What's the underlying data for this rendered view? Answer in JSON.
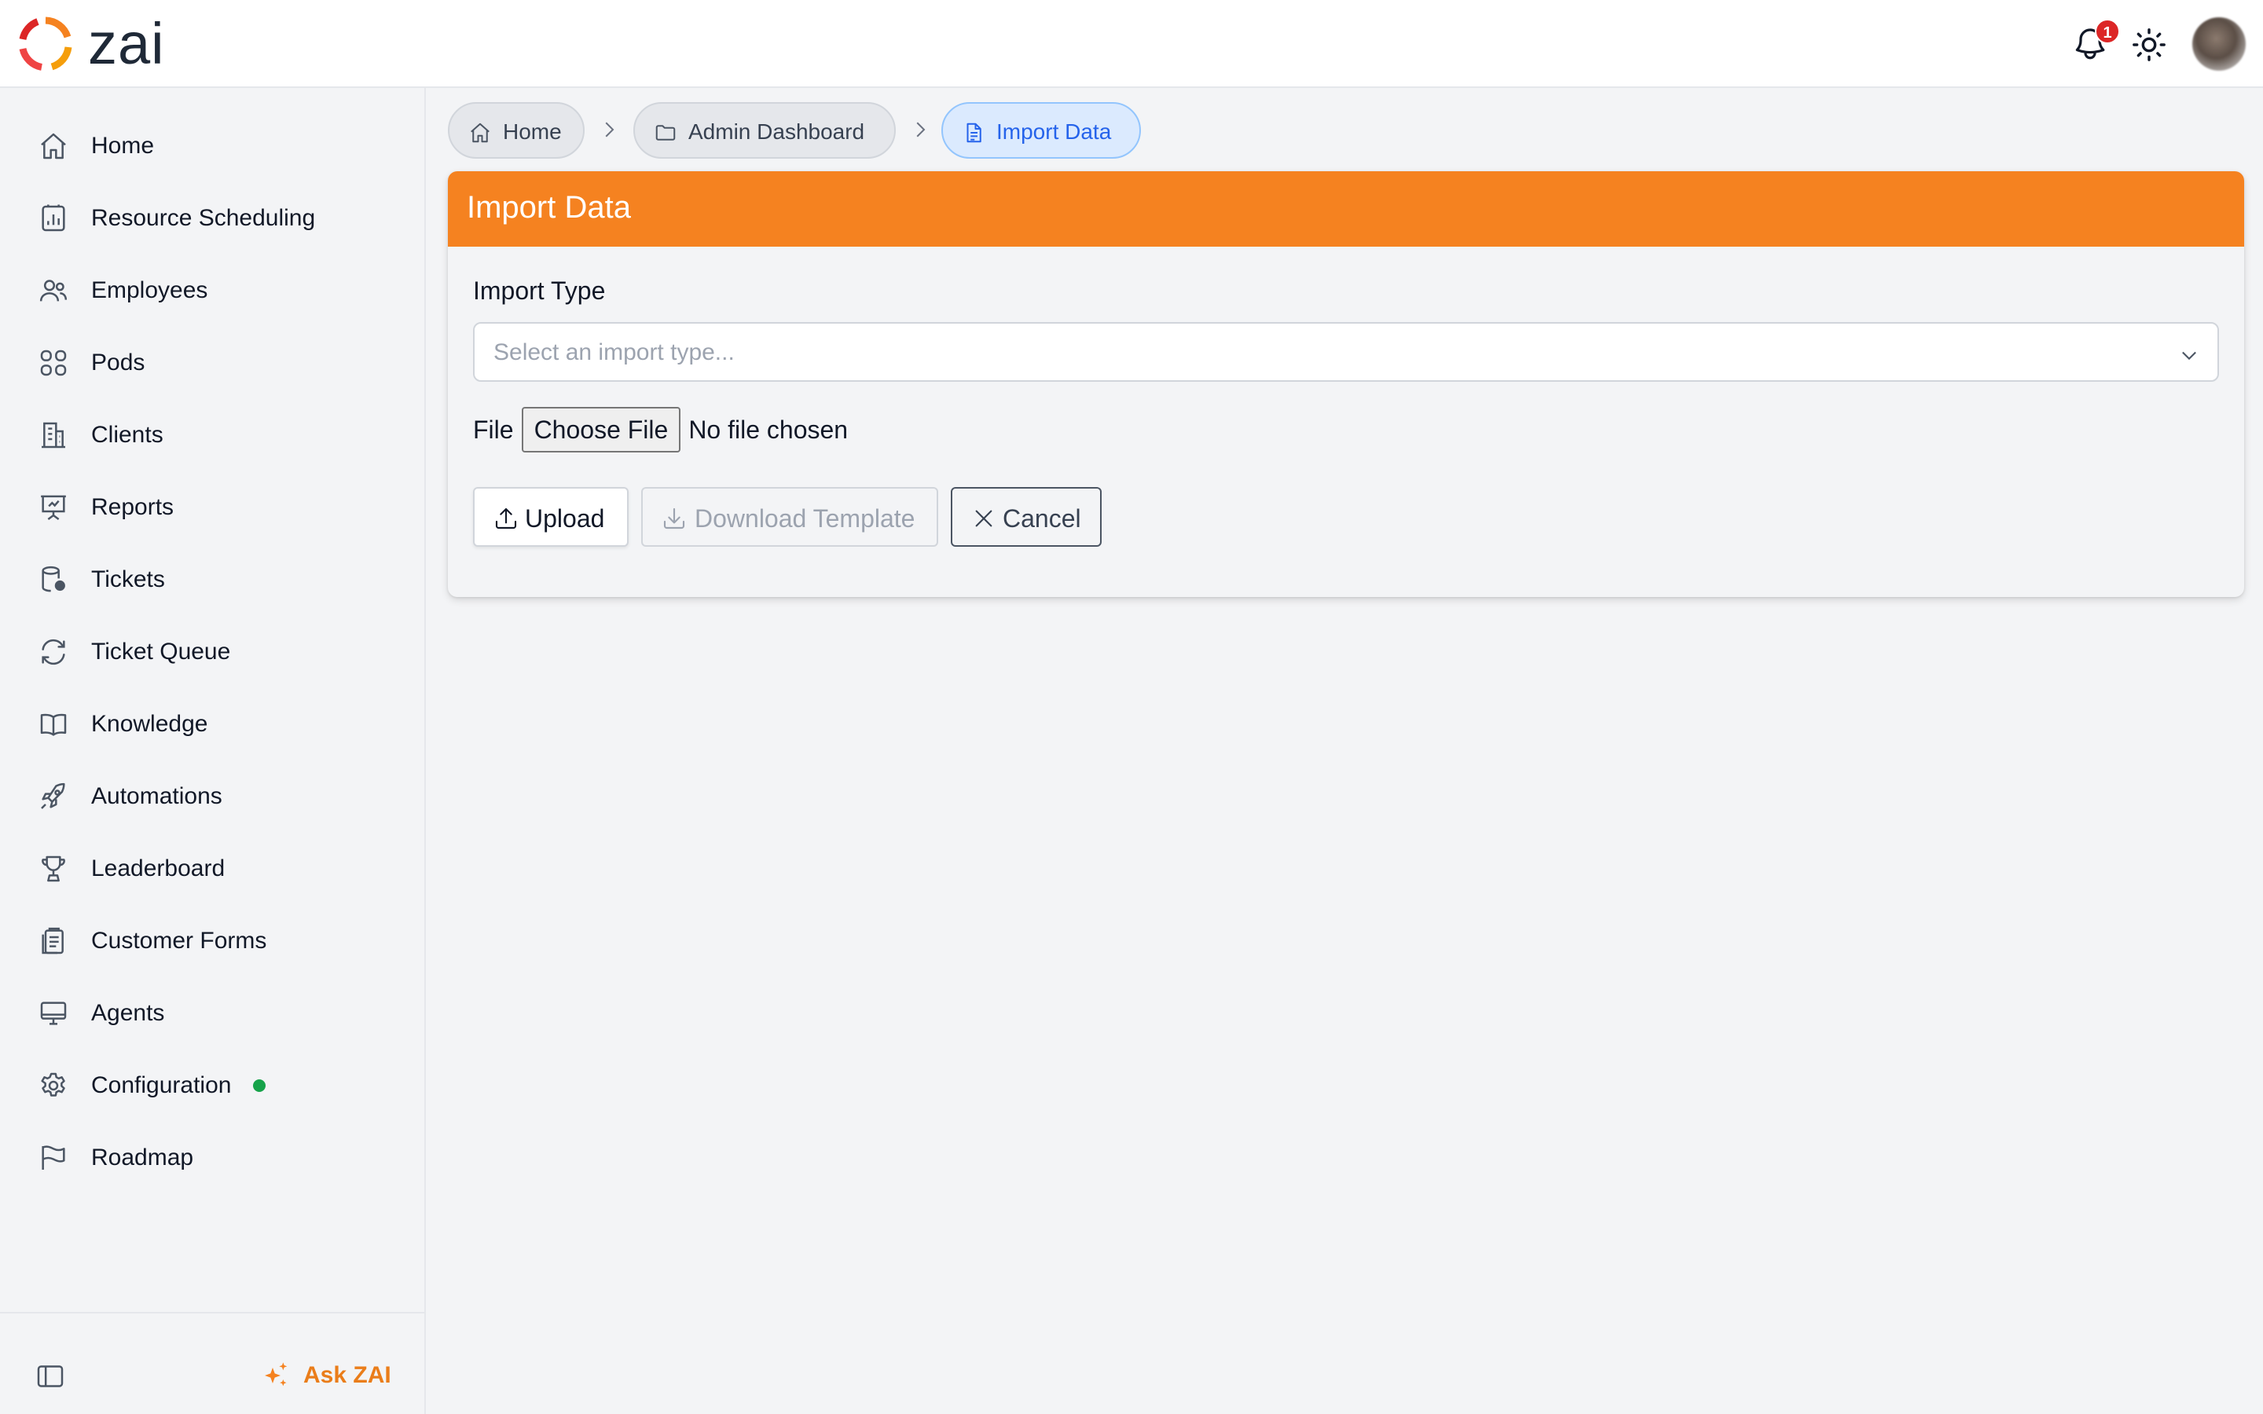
{
  "app": {
    "name": "zai"
  },
  "header": {
    "notification_count": "1",
    "icons": [
      "bell-icon",
      "sun-icon",
      "avatar"
    ]
  },
  "sidebar": {
    "items": [
      {
        "label": "Home",
        "icon": "home-icon"
      },
      {
        "label": "Resource Scheduling",
        "icon": "calendar-chart-icon"
      },
      {
        "label": "Employees",
        "icon": "users-icon"
      },
      {
        "label": "Pods",
        "icon": "grid-icon"
      },
      {
        "label": "Clients",
        "icon": "building-icon"
      },
      {
        "label": "Reports",
        "icon": "presentation-chart-icon"
      },
      {
        "label": "Tickets",
        "icon": "database-user-icon"
      },
      {
        "label": "Ticket Queue",
        "icon": "refresh-icon"
      },
      {
        "label": "Knowledge",
        "icon": "book-icon"
      },
      {
        "label": "Automations",
        "icon": "rocket-icon"
      },
      {
        "label": "Leaderboard",
        "icon": "trophy-icon"
      },
      {
        "label": "Customer Forms",
        "icon": "clipboard-icon"
      },
      {
        "label": "Agents",
        "icon": "monitor-icon"
      },
      {
        "label": "Configuration",
        "icon": "gear-icon",
        "status": "active"
      },
      {
        "label": "Roadmap",
        "icon": "flag-icon"
      }
    ],
    "footer": {
      "ask_label": "Ask ZAI",
      "collapse_icon": "sidebar-toggle-icon"
    }
  },
  "breadcrumb": [
    {
      "label": "Home",
      "icon": "home-icon"
    },
    {
      "label": "Admin Dashboard",
      "icon": "folder-icon"
    },
    {
      "label": "Import Data",
      "icon": "document-icon",
      "active": true
    }
  ],
  "form": {
    "title": "Import Data",
    "import_type_label": "Import Type",
    "import_type_placeholder": "Select an import type...",
    "file_label": "File",
    "choose_file_label": "Choose File",
    "no_file_text": "No file chosen",
    "buttons": {
      "upload": "Upload",
      "download_template": "Download Template",
      "cancel": "Cancel"
    }
  },
  "colors": {
    "accent": "#f58220",
    "active_crumb": "#2563eb",
    "status_dot": "#16a34a",
    "badge": "#dc2626"
  }
}
